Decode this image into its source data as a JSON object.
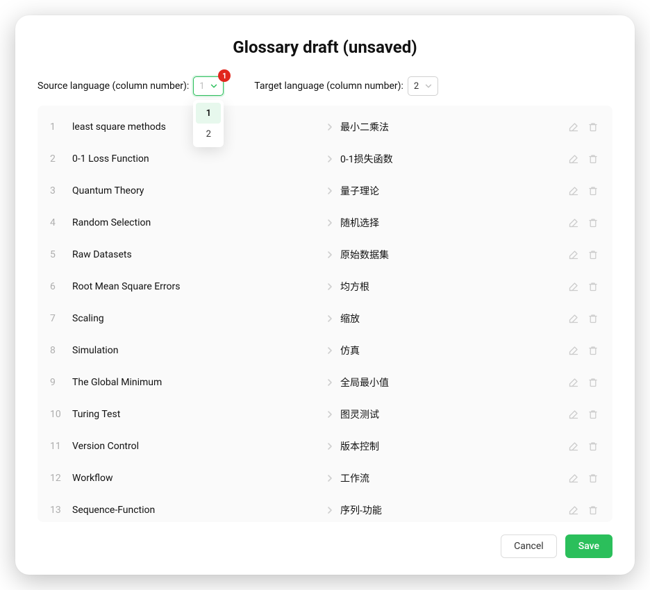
{
  "title": "Glossary draft (unsaved)",
  "source_label": "Source language (column number):",
  "target_label": "Target language (column number):",
  "source_select": {
    "value": "1",
    "options": [
      "1",
      "2"
    ],
    "badge": "1"
  },
  "target_select": {
    "value": "2"
  },
  "rows": [
    {
      "idx": "1",
      "src": "least square methods",
      "tgt": "最小二乘法"
    },
    {
      "idx": "2",
      "src": "0-1 Loss Function",
      "tgt": "0-1损失函数"
    },
    {
      "idx": "3",
      "src": "Quantum Theory",
      "tgt": "量子理论"
    },
    {
      "idx": "4",
      "src": "Random Selection",
      "tgt": "随机选择"
    },
    {
      "idx": "5",
      "src": "Raw Datasets",
      "tgt": "原始数据集"
    },
    {
      "idx": "6",
      "src": "Root Mean Square Errors",
      "tgt": "均方根"
    },
    {
      "idx": "7",
      "src": "Scaling",
      "tgt": "缩放"
    },
    {
      "idx": "8",
      "src": "Simulation",
      "tgt": "仿真"
    },
    {
      "idx": "9",
      "src": "The Global Minimum",
      "tgt": "全局最小值"
    },
    {
      "idx": "10",
      "src": "Turing Test",
      "tgt": "图灵测试"
    },
    {
      "idx": "11",
      "src": "Version Control",
      "tgt": "版本控制"
    },
    {
      "idx": "12",
      "src": "Workflow",
      "tgt": "工作流"
    },
    {
      "idx": "13",
      "src": "Sequence-Function",
      "tgt": "序列-功能"
    }
  ],
  "buttons": {
    "cancel": "Cancel",
    "save": "Save"
  }
}
